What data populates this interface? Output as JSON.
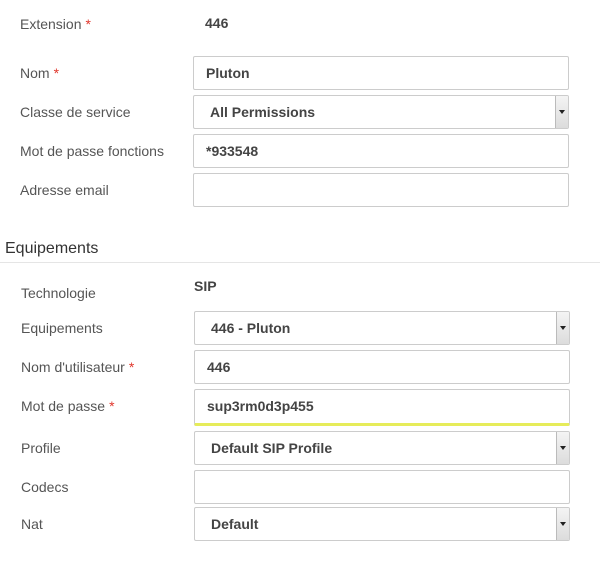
{
  "general": {
    "extension_label": "Extension",
    "extension_value": "446",
    "nom_label": "Nom",
    "nom_value": "Pluton",
    "classe_label": "Classe de service",
    "classe_value": "All Permissions",
    "motdepasse_fonctions_label": "Mot de passe fonctions",
    "motdepasse_fonctions_value": "*933548",
    "email_label": "Adresse email",
    "email_value": "",
    "required_mark": "*"
  },
  "equipements": {
    "section_title": "Equipements",
    "technologie_label": "Technologie",
    "technologie_value": "SIP",
    "equipements_label": "Equipements",
    "equipements_value": "446 - Pluton",
    "username_label": "Nom d'utilisateur",
    "username_value": "446",
    "password_label": "Mot de passe",
    "password_value": "sup3rm0d3p455",
    "profile_label": "Profile",
    "profile_value": "Default SIP Profile",
    "codecs_label": "Codecs",
    "codecs_value": "",
    "nat_label": "Nat",
    "nat_value": "Default"
  },
  "colors": {
    "required": "#e0362c",
    "focus_underline": "#e6ec5a"
  }
}
